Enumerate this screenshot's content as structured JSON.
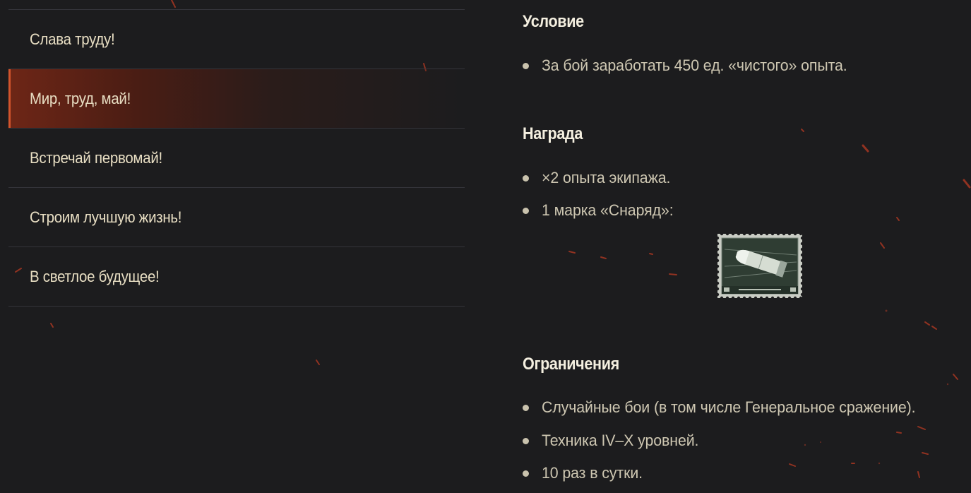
{
  "missions": [
    {
      "label": "Слава труду!",
      "active": false
    },
    {
      "label": "Мир, труд, май!",
      "active": true
    },
    {
      "label": "Встречай первомай!",
      "active": false
    },
    {
      "label": "Строим лучшую жизнь!",
      "active": false
    },
    {
      "label": "В светлое будущее!",
      "active": false
    }
  ],
  "details": {
    "condition": {
      "title": "Условие",
      "items": [
        "За бой заработать 450 ед. «чистого» опыта."
      ]
    },
    "reward": {
      "title": "Награда",
      "items": [
        "×2 опыта экипажа.",
        "1 марка «Снаряд»:"
      ],
      "stamp_icon": "shell-stamp-icon"
    },
    "restrictions": {
      "title": "Ограничения",
      "items": [
        "Случайные бои (в том числе Генеральное сражение).",
        "Техника IV–X уровней.",
        "10 раз в сутки."
      ]
    }
  },
  "colors": {
    "background": "#1c1c1e",
    "accent": "#d2542c",
    "text": "#e8dec3",
    "title": "#f4efe0",
    "divider": "#34343a"
  }
}
